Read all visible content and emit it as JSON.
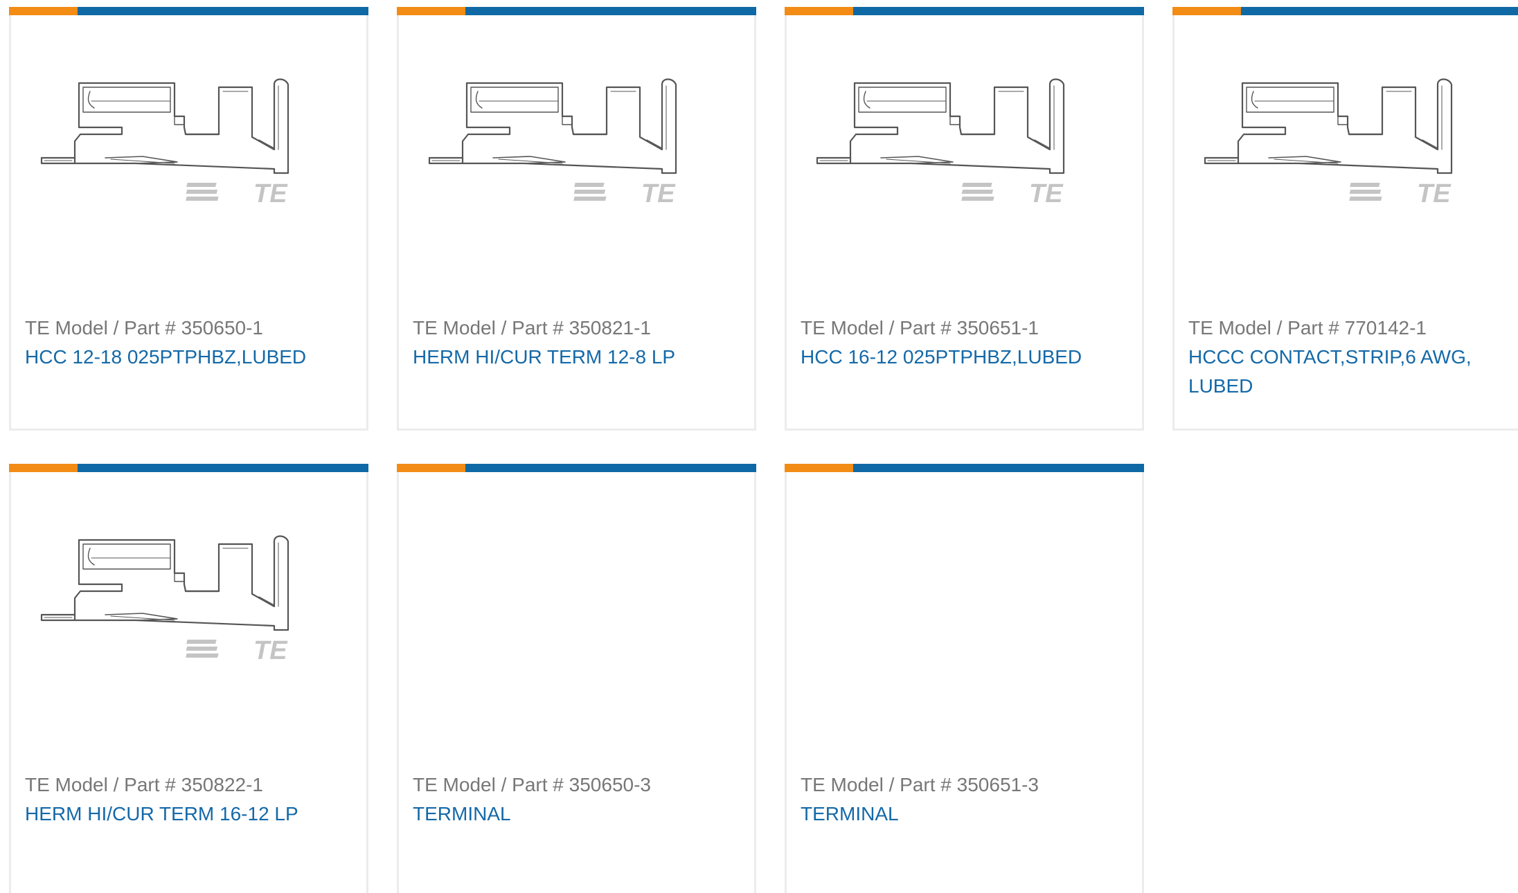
{
  "colors": {
    "accent_orange": "#f28c14",
    "accent_blue": "#0f69a5",
    "link_blue": "#1469a8",
    "label_gray": "#777777",
    "card_border": "#ececec",
    "logo_gray": "#c4c4c4"
  },
  "product_grid": {
    "part_prefix": "TE Model / Part #",
    "logo_text": "TE",
    "cards": [
      {
        "part_number": "350650-1",
        "title": "HCC 12-18 025PTPHBZ,LUBED",
        "has_image": true,
        "image_icon": "terminal-drawing"
      },
      {
        "part_number": "350821-1",
        "title": "HERM HI/CUR TERM 12-8 LP",
        "has_image": true,
        "image_icon": "terminal-drawing"
      },
      {
        "part_number": "350651-1",
        "title": "HCC 16-12 025PTPHBZ,LUBED",
        "has_image": true,
        "image_icon": "terminal-drawing"
      },
      {
        "part_number": "770142-1",
        "title": "HCCC CONTACT,STRIP,6 AWG, LUBED",
        "has_image": true,
        "image_icon": "terminal-drawing"
      },
      {
        "part_number": "350822-1",
        "title": "HERM HI/CUR TERM 16-12 LP",
        "has_image": true,
        "image_icon": "terminal-drawing"
      },
      {
        "part_number": "350650-3",
        "title": "TERMINAL",
        "has_image": false
      },
      {
        "part_number": "350651-3",
        "title": "TERMINAL",
        "has_image": false
      }
    ]
  }
}
